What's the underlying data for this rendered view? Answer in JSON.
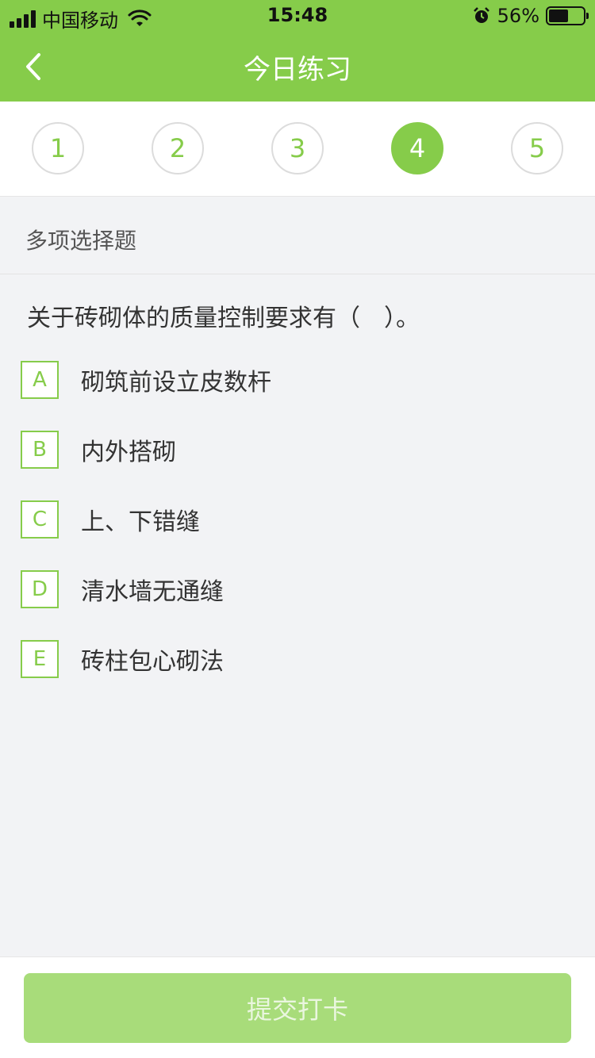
{
  "status_bar": {
    "carrier": "中国移动",
    "time": "15:48",
    "battery_percent": "56%",
    "battery_level": 0.56,
    "icons": [
      "signal-icon",
      "wifi-icon",
      "alarm-icon",
      "battery-icon"
    ]
  },
  "nav": {
    "title": "今日练习",
    "back_icon": "chevron-left-icon"
  },
  "steps": {
    "items": [
      "1",
      "2",
      "3",
      "4",
      "5"
    ],
    "active_index": 3
  },
  "section": {
    "title": "多项选择题"
  },
  "question": {
    "text": "关于砖砌体的质量控制要求有（　）。",
    "options": [
      {
        "letter": "A",
        "text": "砌筑前设立皮数杆"
      },
      {
        "letter": "B",
        "text": "内外搭砌"
      },
      {
        "letter": "C",
        "text": "上、下错缝"
      },
      {
        "letter": "D",
        "text": "清水墙无通缝"
      },
      {
        "letter": "E",
        "text": "砖柱包心砌法"
      }
    ]
  },
  "footer": {
    "submit_label": "提交打卡"
  },
  "colors": {
    "accent": "#86cc4a",
    "submit_disabled": "#a8dc7a",
    "background": "#f2f3f5"
  }
}
